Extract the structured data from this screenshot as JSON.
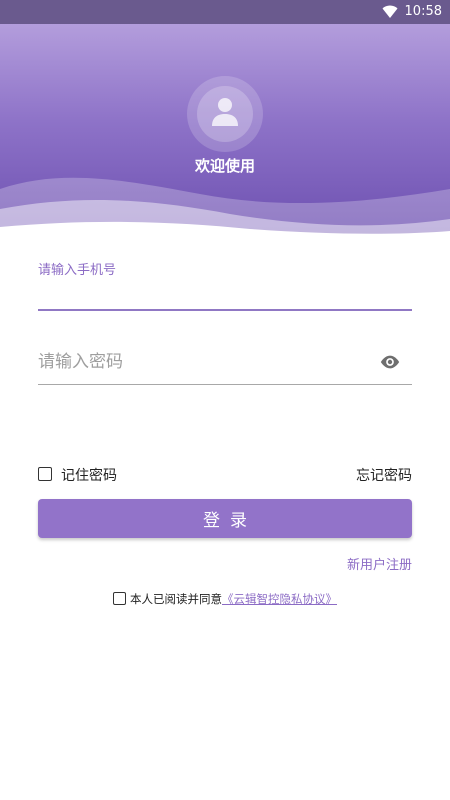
{
  "status_bar": {
    "time": "10:58",
    "wifi_icon": "wifi-icon"
  },
  "header": {
    "avatar_icon": "user-icon",
    "welcome_text": "欢迎使用",
    "gradient_colors": [
      "#b39ddc",
      "#6c4fb0"
    ]
  },
  "form": {
    "phone": {
      "label": "请输入手机号",
      "value": ""
    },
    "password": {
      "placeholder": "请输入密码",
      "value": "",
      "visibility_icon": "eye-icon"
    },
    "remember_label": "记住密码",
    "remember_checked": false,
    "forgot_label": "忘记密码",
    "login_label": "登录",
    "register_label": "新用户注册",
    "agreement": {
      "checked": false,
      "text": "本人已阅读并同意",
      "link_text": "《云辑智控隐私协议》"
    }
  },
  "colors": {
    "accent": "#9273c9",
    "link": "#8c6cc5"
  }
}
